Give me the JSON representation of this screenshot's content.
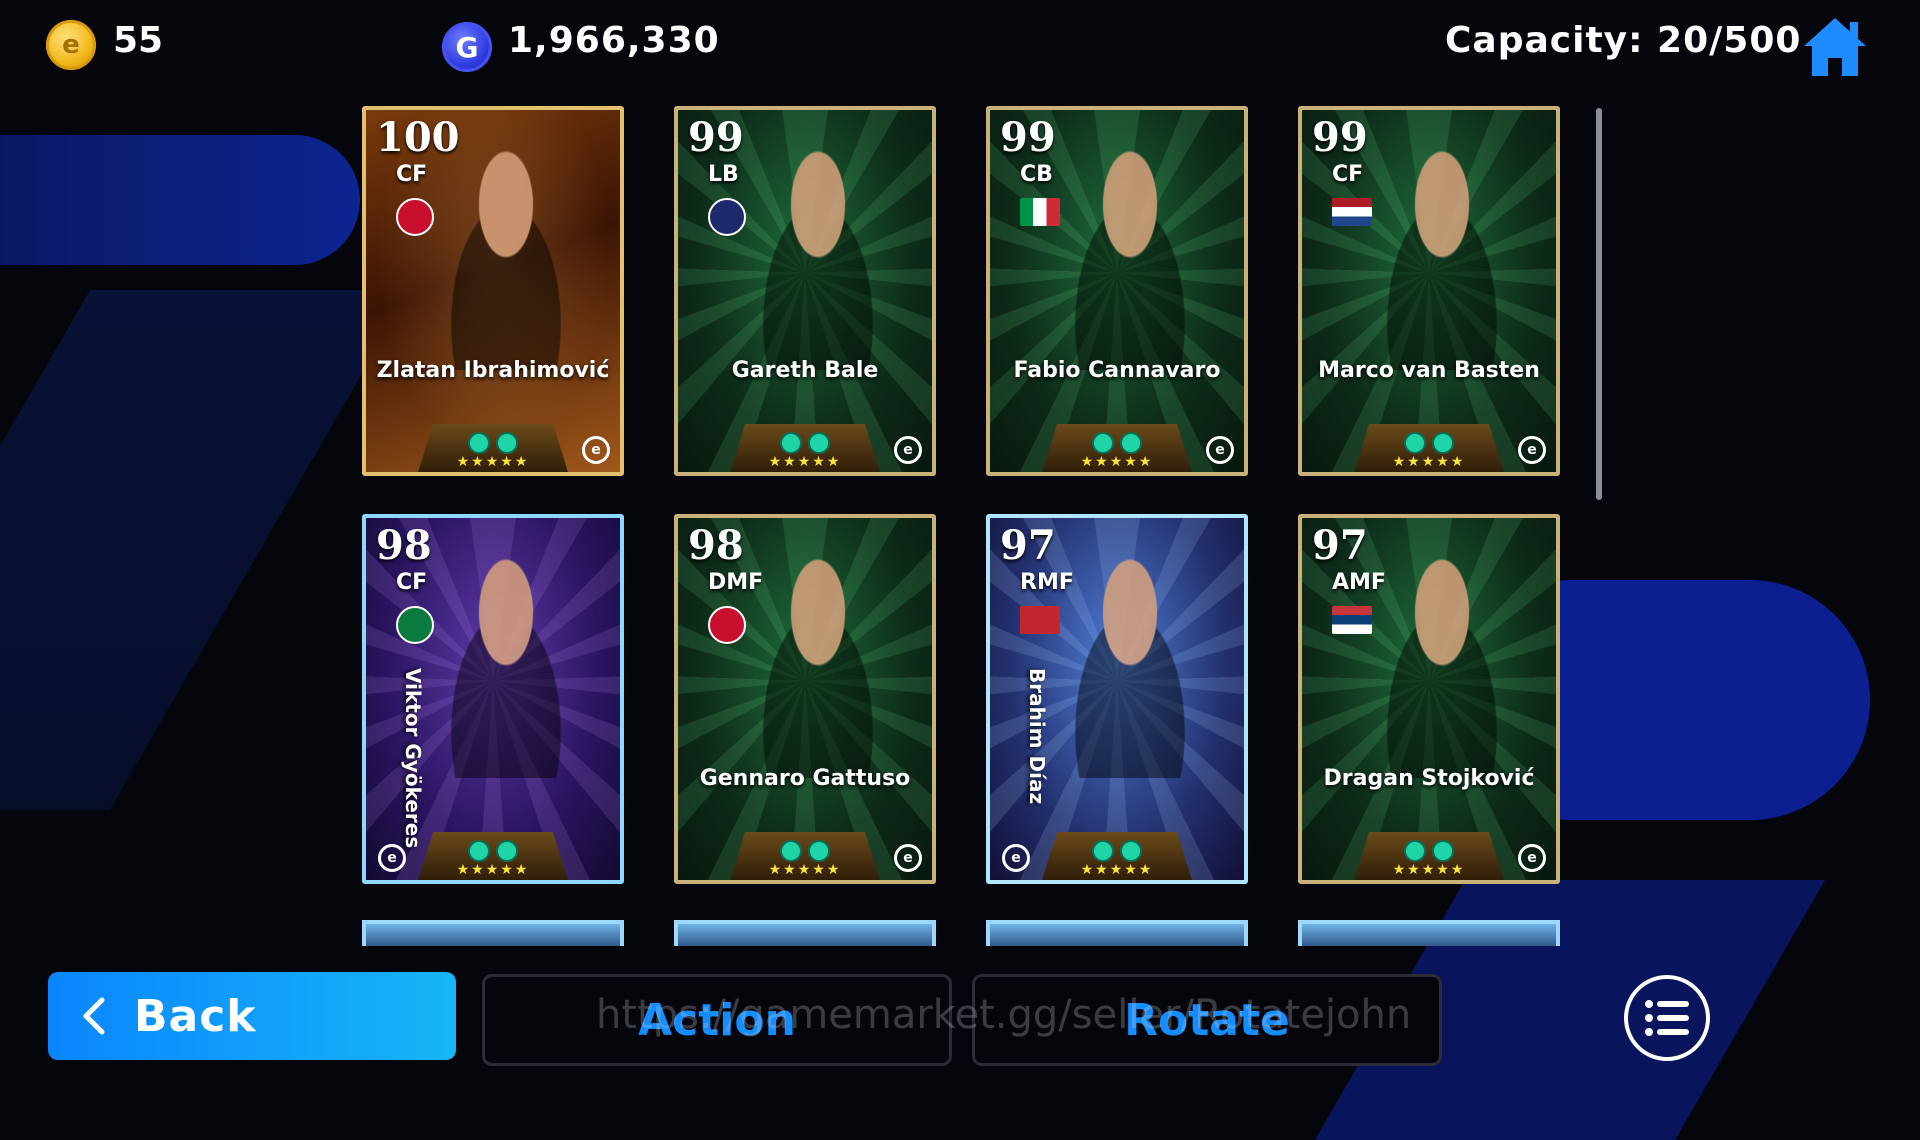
{
  "currency": {
    "coins": "55",
    "gp": "1,966,330",
    "capacity": "Capacity: 20/500"
  },
  "cards": [
    {
      "rating": "100",
      "position": "CF",
      "name": "Zlatan Ibrahimović",
      "style": "gold",
      "badge_color": "#c8102e",
      "badge_shape": "round",
      "stars": "★★★★★"
    },
    {
      "rating": "99",
      "position": "LB",
      "name": "Gareth Bale",
      "style": "green",
      "badge_color": "#1c2a6b",
      "badge_shape": "round",
      "stars": "★★★★★"
    },
    {
      "rating": "99",
      "position": "CB",
      "name": "Fabio Cannavaro",
      "style": "green",
      "badge_color": "flag-italy",
      "badge_shape": "flag",
      "stars": "★★★★★"
    },
    {
      "rating": "99",
      "position": "CF",
      "name": "Marco van Basten",
      "style": "green",
      "badge_color": "flag-netherlands",
      "badge_shape": "flag",
      "stars": "★★★★★"
    },
    {
      "rating": "98",
      "position": "CF",
      "name": "Viktor Gyökeres",
      "style": "purple",
      "badge_color": "#0a7a3e",
      "badge_shape": "round",
      "stars": "★★★★★"
    },
    {
      "rating": "98",
      "position": "DMF",
      "name": "Gennaro Gattuso",
      "style": "green",
      "badge_color": "#c8102e",
      "badge_shape": "round",
      "stars": "★★★★★"
    },
    {
      "rating": "97",
      "position": "RMF",
      "name": "Brahim Díaz",
      "style": "blue",
      "badge_color": "flag-morocco",
      "badge_shape": "flag",
      "stars": "★★★★★"
    },
    {
      "rating": "97",
      "position": "AMF",
      "name": "Dragan Stojković",
      "style": "green",
      "badge_color": "flag-serbia",
      "badge_shape": "flag",
      "stars": "★★★★★"
    }
  ],
  "buttons": {
    "back": "Back",
    "action": "Action",
    "rotate": "Rotate"
  },
  "watermark": "https://gamemarket.gg/seller/Rotatejohn",
  "icons": {
    "coin": "e",
    "gp": "G",
    "efootball": "e"
  },
  "colors": {
    "accent": "#148dff",
    "back_button": "#0a86ff"
  }
}
